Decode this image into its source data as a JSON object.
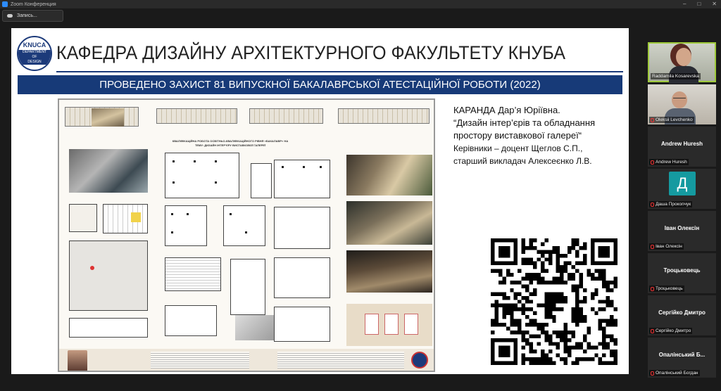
{
  "window": {
    "title": "Zoom Конференция",
    "recording_label": "Запись..."
  },
  "slide": {
    "logo": {
      "line1": "KNUCA",
      "line2": "DEPARTMENT",
      "line3": "OF",
      "line4": "DESIGN"
    },
    "main_title": "КАФЕДРА ДИЗАЙНУ АРХІТЕКТУРНОГО ФАКУЛЬТЕТУ КНУБА",
    "subtitle": "ПРОВЕДЕНО ЗАХИСТ 81 ВИПУСКНОЇ БАКАЛАВРСЬКОЇ АТЕСТАЦІЙНОЇ РОБОТИ (2022)",
    "poster_title": "КВАЛІФІКАЦІЙНА РОБОТА ОСВІТНЬО-КВАЛІФІКАЦІЙНОГО РІВНЯ «БАКАЛАВР» НА ТЕМУ: ДИЗАЙН ІНТЕР'ЄРУ ВИСТАВКОВОЇ ГАЛЕРЕЇ",
    "info": {
      "line1": "КАРАНДА Дар’я Юріївна.",
      "line2": "“Дизайн інтер’єрів та обладнання",
      "line3": "простору виставкової галереї“",
      "line4": "Керівники – доцент Щеглов С.П.,",
      "line5": "старший викладач Алексеєнко Л.В."
    }
  },
  "participants": [
    {
      "name": "Raddamila Kosarevska",
      "type": "video",
      "active": true
    },
    {
      "name": "Oleksii Levchenko",
      "type": "video",
      "active": false
    },
    {
      "name": "Andrew Huresh",
      "display": "Andrew Huresh",
      "type": "name",
      "active": false
    },
    {
      "name": "Даша Прокопчук",
      "display": "Д",
      "type": "avatar",
      "active": false
    },
    {
      "name": "Іван Олексін",
      "display": "Іван Олексін",
      "type": "name",
      "active": false
    },
    {
      "name": "Троцьковець",
      "display": "Троцьковець",
      "type": "name",
      "active": false
    },
    {
      "name": "Сергійко Дмитро",
      "display": "Сергійко Дмитро",
      "type": "name",
      "active": false
    },
    {
      "name": "Опалінський Богдан",
      "display": "Опалінський Б...",
      "type": "name",
      "active": false
    }
  ],
  "colors": {
    "brand_blue": "#173a78",
    "active_speaker": "#9ec93a",
    "avatar_teal": "#159aa0",
    "muted_red": "#e33333"
  }
}
